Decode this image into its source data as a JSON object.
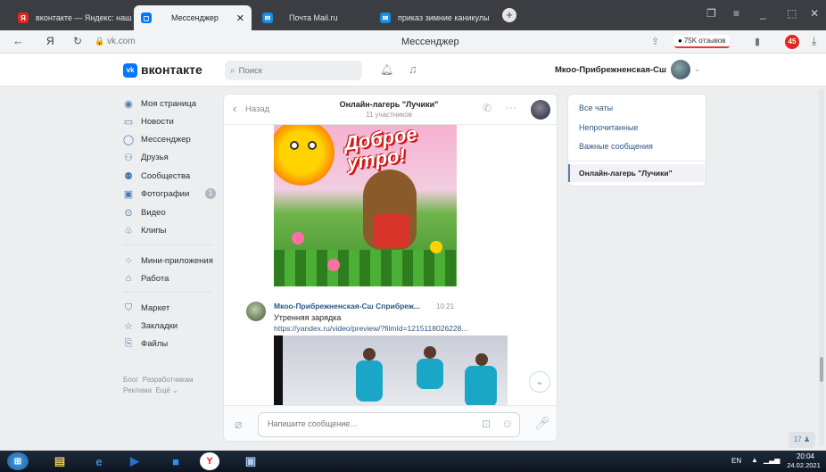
{
  "browser": {
    "tabs": [
      {
        "label": "вконтакте — Яндекс: нашл",
        "favicon": "yandex-icon"
      },
      {
        "label": "Мессенджер",
        "favicon": "vk-icon"
      },
      {
        "label": "Почта Mail.ru",
        "favicon": "mail-icon"
      },
      {
        "label": "приказ зимние каникулы",
        "favicon": "mail-icon"
      }
    ],
    "url": "vk.com",
    "page_title": "Мессенджер",
    "reviews": "75K отзывов",
    "badge": "45"
  },
  "vk": {
    "logo_text": "вконтакте",
    "search_placeholder": "Поиск",
    "user_name": "Мкоо-Прибрежненская-Сш",
    "menu": [
      {
        "label": "Моя страница",
        "icon": "user-circle-icon"
      },
      {
        "label": "Новости",
        "icon": "news-icon"
      },
      {
        "label": "Мессенджер",
        "icon": "message-icon"
      },
      {
        "label": "Друзья",
        "icon": "friends-icon"
      },
      {
        "label": "Сообщества",
        "icon": "communities-icon"
      },
      {
        "label": "Фотографии",
        "icon": "photo-icon",
        "badge": "1"
      },
      {
        "label": "Видео",
        "icon": "video-icon"
      },
      {
        "label": "Клипы",
        "icon": "clips-icon"
      },
      {
        "label": "Мини-приложения",
        "icon": "apps-icon"
      },
      {
        "label": "Работа",
        "icon": "work-icon"
      },
      {
        "label": "Маркет",
        "icon": "market-icon"
      },
      {
        "label": "Закладки",
        "icon": "bookmark-icon"
      },
      {
        "label": "Файлы",
        "icon": "file-icon"
      }
    ],
    "footer_links": [
      "Блог",
      "Разработчикам",
      "Реклама",
      "Ещё"
    ]
  },
  "chat": {
    "back_label": "Назад",
    "title": "Онлайн-лагерь \"Лучики\"",
    "subtitle": "11 участников",
    "image_text": "Доброе утро!",
    "message": {
      "author": "Мкоо-Прибрежненская-Сш Сприбреж...",
      "time": "10:21",
      "text": "Утренняя зарядка",
      "link": "https://yandex.ru/video/preview/?filmId=1215118026228..."
    },
    "input_placeholder": "Напишите сообщение..."
  },
  "right_panel": {
    "items": [
      "Все чаты",
      "Непрочитанные",
      "Важные сообщения"
    ],
    "active_chat": "Онлайн-лагерь \"Лучики\""
  },
  "floating_counter": "17",
  "taskbar": {
    "lang": "EN",
    "time": "20:04",
    "date": "24.02.2021"
  },
  "colors": {
    "vk_blue": "#0077ff",
    "link": "#2a5885",
    "tab_bar": "#3b3d42"
  }
}
